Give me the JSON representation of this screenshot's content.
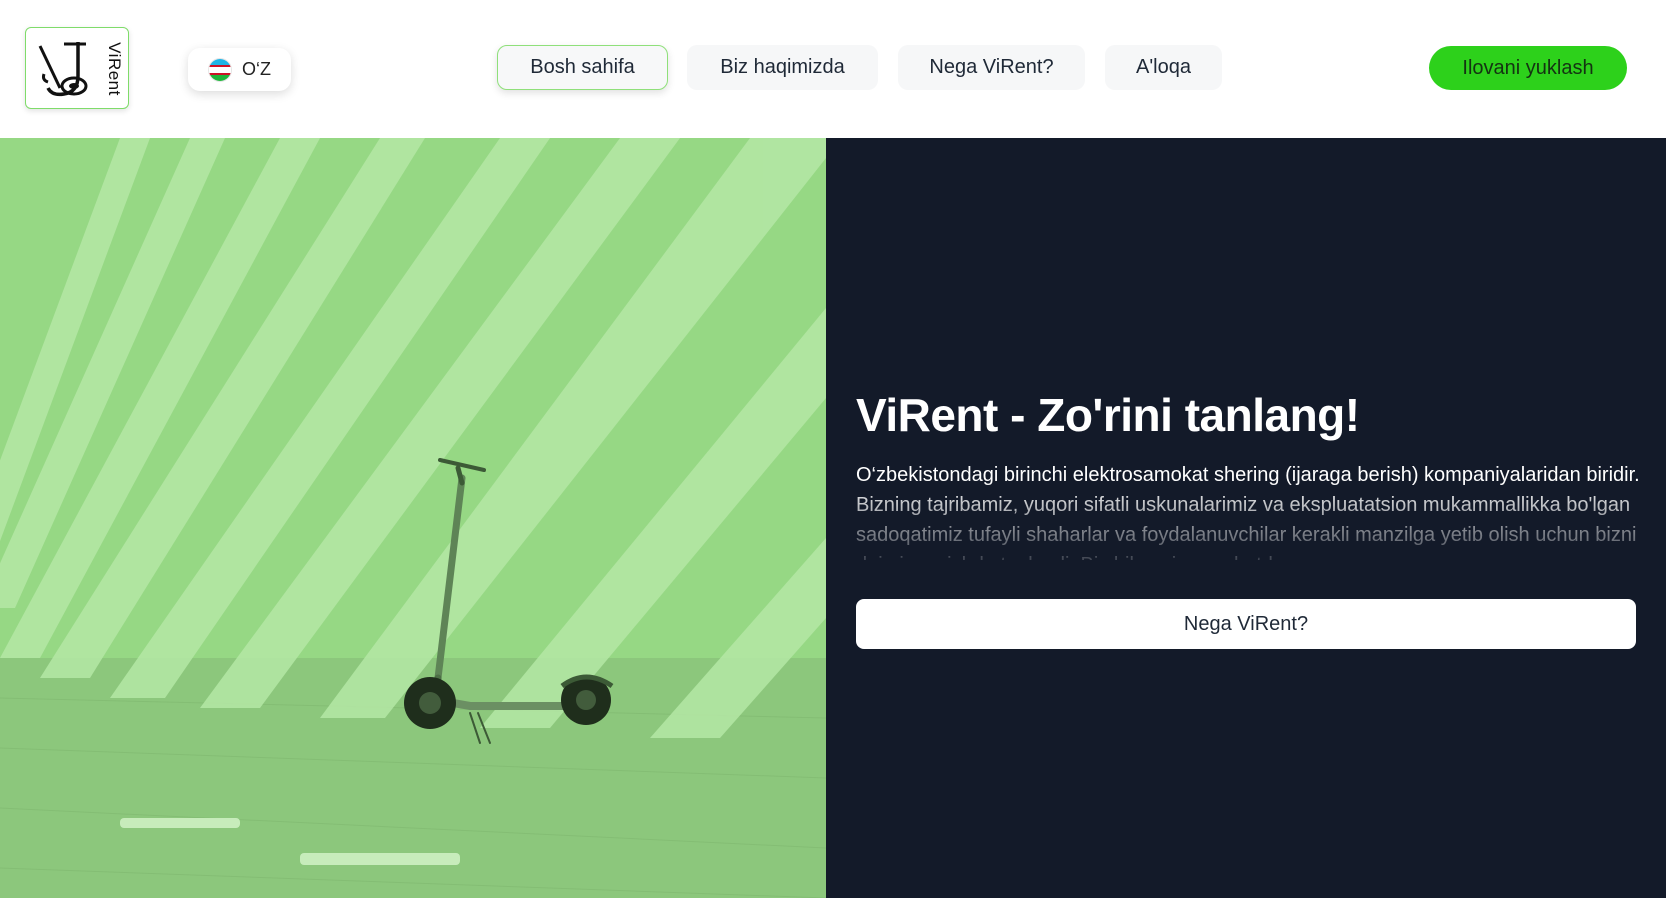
{
  "header": {
    "logo_text": "ViRent",
    "language": {
      "label": "O‘Z",
      "flag": "uzbekistan-flag-icon"
    },
    "nav": [
      {
        "label": "Bosh sahifa",
        "active": true
      },
      {
        "label": "Biz haqimizda",
        "active": false
      },
      {
        "label": "Nega ViRent?",
        "active": false
      },
      {
        "label": "A'loqa",
        "active": false
      }
    ],
    "cta_label": "Ilovani yuklash"
  },
  "hero": {
    "image": "scooter-photo",
    "title": "ViRent - Zo'rini tanlang!",
    "description": "O‘zbekistondagi birinchi elektrosamokat shering (ijaraga berish) kompaniyalaridan biridir. Bizning tajribamiz, yuqori sifatli uskunalarimiz va ekspluatatsion mukammallikka bo'lgan sadoqatimiz tufayli shaharlar va foydalanuvchilar kerakli manzilga yetib olish uchun bizni doimiy ravishda tanlaydi. Biz bilan siz sayohatda",
    "button_label": "Nega ViRent?"
  },
  "colors": {
    "accent": "#2dd11b",
    "hero_dark": "#131a29",
    "active_border": "#8fe07a",
    "image_tint": "#7ed36a"
  }
}
